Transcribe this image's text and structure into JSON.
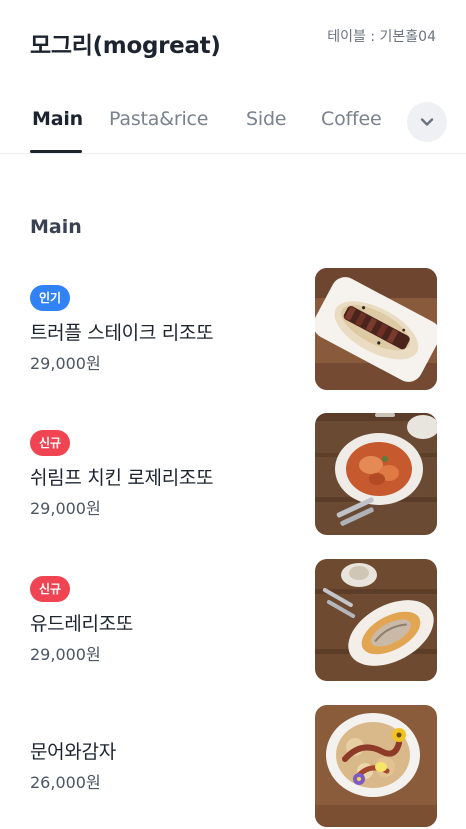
{
  "header": {
    "store_name": "모그리(mogreat)",
    "table_label": "테이블 : 기본홀04"
  },
  "tabs": [
    {
      "label": "Main",
      "active": true
    },
    {
      "label": "Pasta&rice",
      "active": false
    },
    {
      "label": "Side",
      "active": false
    },
    {
      "label": "Coffee",
      "active": false
    }
  ],
  "tabs_more_icon": "chevron-down-icon",
  "section": {
    "title": "Main"
  },
  "items": [
    {
      "badge": "인기",
      "badge_color": "#3182f6",
      "name": "트러플 스테이크 리조또",
      "price": "29,000원",
      "image": "steak-risotto-photo"
    },
    {
      "badge": "신규",
      "badge_color": "#f04452",
      "name": "쉬림프 치킨 로제리조또",
      "price": "29,000원",
      "image": "shrimp-chicken-rose-risotto-photo"
    },
    {
      "badge": "신규",
      "badge_color": "#f04452",
      "name": "유드레리조또",
      "price": "29,000원",
      "image": "risotto-photo"
    },
    {
      "badge": "",
      "badge_color": "",
      "name": "문어와감자",
      "price": "26,000원",
      "image": "octopus-potato-photo"
    }
  ],
  "colors": {
    "primary_text": "#1d2430",
    "muted_text": "#7a828f",
    "popular_badge": "#3182f6",
    "new_badge": "#f04452"
  }
}
